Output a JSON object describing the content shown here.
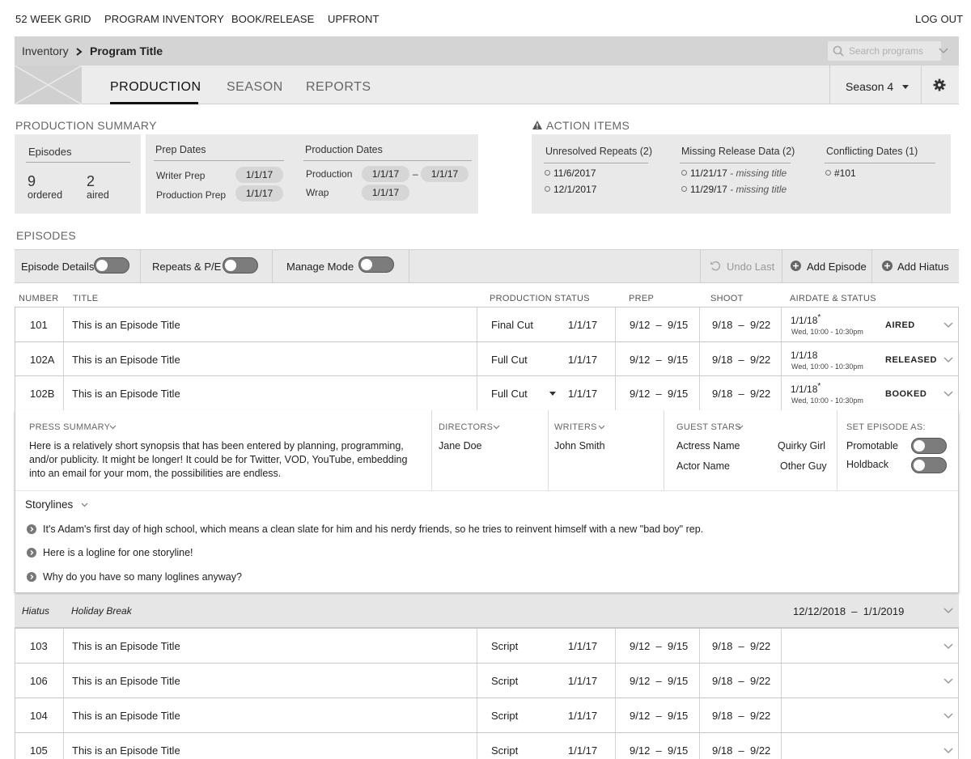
{
  "nav": {
    "items": [
      "52 WEEK GRID",
      "PROGRAM INVENTORY",
      "BOOK/RELEASE",
      "UPFRONT"
    ],
    "logout": "LOG OUT"
  },
  "breadcrumb": {
    "root": "Inventory",
    "current": "Program Title"
  },
  "search": {
    "placeholder": "Search programs"
  },
  "tabs": [
    "PRODUCTION",
    "SEASON",
    "REPORTS"
  ],
  "season": {
    "label": "Season 4"
  },
  "production_summary": {
    "heading": "PRODUCTION SUMMARY",
    "episodes": {
      "title": "Episodes",
      "ordered_count": "9",
      "ordered_label": "ordered",
      "aired_count": "2",
      "aired_label": "aired"
    },
    "prep": {
      "title": "Prep Dates",
      "writer_label": "Writer Prep",
      "writer_value": "1/1/17",
      "prod_label": "Production Prep",
      "prod_value": "1/1/17"
    },
    "production": {
      "title": "Production Dates",
      "production_label": "Production",
      "start": "1/1/17",
      "dash": "–",
      "end": "1/1/17",
      "wrap_label": "Wrap",
      "wrap_value": "1/1/17"
    }
  },
  "action_items": {
    "heading": "ACTION ITEMS",
    "repeats": {
      "title": "Unresolved Repeats (2)",
      "items": [
        "11/6/2017",
        "12/1/2017"
      ]
    },
    "missing": {
      "title": "Missing Release Data (2)",
      "items": [
        {
          "date": "11/21/17",
          "note": "- missing title"
        },
        {
          "date": "11/29/17",
          "note": "- missing title"
        }
      ]
    },
    "conflicts": {
      "title": "Conflicting Dates (1)",
      "items": [
        "#101"
      ]
    }
  },
  "episodes_heading": "EPISODES",
  "toolbar": {
    "episode_details": "Episode Details",
    "repeats": "Repeats & P/E",
    "manage_mode": "Manage Mode",
    "undo": "Undo Last",
    "add_episode": "Add Episode",
    "add_hiatus": "Add Hiatus"
  },
  "columns": {
    "number": "NUMBER",
    "title": "TITLE",
    "production_status": "PRODUCTION STATUS",
    "prep": "PREP",
    "shoot": "SHOOT",
    "airdate": "AIRDATE & STATUS"
  },
  "episodes_top": [
    {
      "number": "101",
      "title": "This is an Episode Title",
      "status": "Final Cut",
      "status_date": "1/1/17",
      "prep": "9/12  –  9/15",
      "shoot": "9/18  –  9/22",
      "airdate": "1/1/18",
      "star": "*",
      "airtime": "Wed, 10:00 - 10:30pm",
      "air_status": "AIRED"
    },
    {
      "number": "102A",
      "title": "This is an Episode Title",
      "status": "Full Cut",
      "status_date": "1/1/17",
      "prep": "9/12  –  9/15",
      "shoot": "9/18  –  9/22",
      "airdate": "1/1/18",
      "star": "",
      "airtime": "Wed, 10:00 - 10:30pm",
      "air_status": "RELEASED"
    },
    {
      "number": "102B",
      "title": "This is an Episode Title",
      "status": "Full Cut",
      "status_date": "1/1/17",
      "prep": "9/12  –  9/15",
      "shoot": "9/18  –  9/22",
      "airdate": "1/1/18",
      "star": "*",
      "airtime": "Wed, 10:00 - 10:30pm",
      "air_status": "BOOKED"
    }
  ],
  "expanded": {
    "press_summary_label": "PRESS SUMMARY",
    "press_summary": "Here is a relatively short synopsis that has been entered by planning, programming, and/or publicity. It might be longer! It could be for Twitter, VOD, YouTube, embedding into an email for your mom, the possibilities are endless.",
    "directors_label": "DIRECTORS",
    "director": "Jane Doe",
    "writers_label": "WRITERS",
    "writer": "John Smith",
    "guest_stars_label": "GUEST STARS",
    "guest_stars": [
      {
        "actor": "Actress Name",
        "role": "Quirky Girl"
      },
      {
        "actor": "Actor Name",
        "role": "Other Guy"
      }
    ],
    "set_as_label": "SET EPISODE AS:",
    "promotable": "Promotable",
    "holdback": "Holdback",
    "storylines_label": "Storylines",
    "storylines": [
      "It's Adam's first day of high school, which means a clean slate for him and his nerdy friends, so he tries to reinvent himself with a new \"bad boy\" rep.",
      "Here is a logline for one storyline!",
      "Why do you have so many loglines anyway?"
    ]
  },
  "hiatus": {
    "label": "Hiatus",
    "name": "Holiday Break",
    "range": "12/12/2018  –  1/1/2019"
  },
  "episodes_bottom": [
    {
      "number": "103",
      "title": "This is an Episode Title",
      "status": "Script",
      "status_date": "1/1/17",
      "prep": "9/12  –  9/15",
      "shoot": "9/18  –  9/22"
    },
    {
      "number": "106",
      "title": "This is an Episode Title",
      "status": "Script",
      "status_date": "1/1/17",
      "prep": "9/12  –  9/15",
      "shoot": "9/18  –  9/22"
    },
    {
      "number": "104",
      "title": "This is an Episode Title",
      "status": "Script",
      "status_date": "1/1/17",
      "prep": "9/12  –  9/15",
      "shoot": "9/18  –  9/22"
    },
    {
      "number": "105",
      "title": "This is an Episode Title",
      "status": "Script",
      "status_date": "1/1/17",
      "prep": "9/12  –  9/15",
      "shoot": "9/18  –  9/22"
    }
  ]
}
